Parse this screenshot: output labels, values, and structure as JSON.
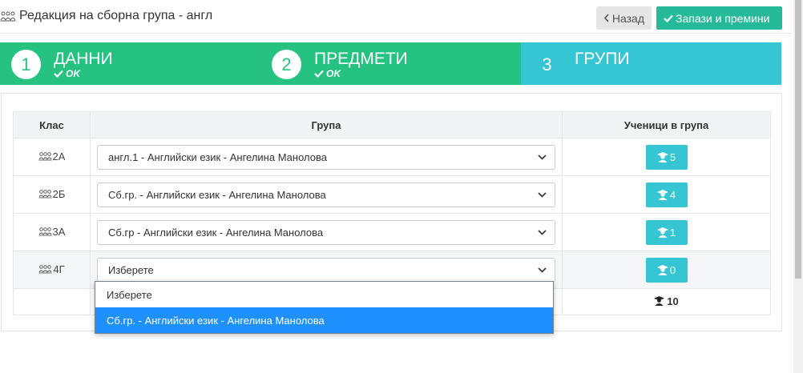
{
  "header": {
    "title": "Редакция на сборна група - англ",
    "back_label": "Назад",
    "save_label": "Запази и премини"
  },
  "wizard": {
    "steps": [
      {
        "num": "1",
        "label": "ДАННИ",
        "status": "OK"
      },
      {
        "num": "2",
        "label": "ПРЕДМЕТИ",
        "status": "OK"
      },
      {
        "num": "3",
        "label": "ГРУПИ",
        "status": ""
      }
    ]
  },
  "table": {
    "headers": [
      "Клас",
      "Група",
      "Ученици в група"
    ],
    "rows": [
      {
        "class": "2А",
        "group": "англ.1 - Английски език - Ангелина Манолова",
        "count": "5"
      },
      {
        "class": "2Б",
        "group": "Сб.гр. - Английски език - Ангелина Манолова",
        "count": "4"
      },
      {
        "class": "3А",
        "group": "Сб.гр - Английски език - Ангелина Манолова",
        "count": "1"
      },
      {
        "class": "4Г",
        "group": "Изберете",
        "count": "0"
      }
    ],
    "total": "10"
  },
  "dropdown": {
    "options": [
      "Изберете",
      "Сб.гр. - Английски език - Ангелина Манолова"
    ],
    "highlighted_index": 1
  },
  "colors": {
    "done_step": "#26c281",
    "active_step": "#36c6d3",
    "save_button": "#26b99a",
    "count_badge": "#36c6d3",
    "highlight": "#1e90ff"
  }
}
